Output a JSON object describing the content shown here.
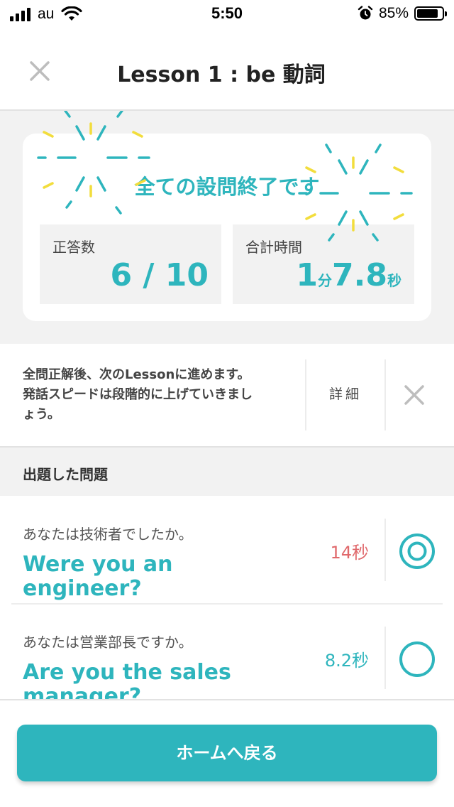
{
  "status_bar": {
    "carrier": "au",
    "time": "5:50",
    "battery": "85%",
    "battery_level": 0.85
  },
  "nav": {
    "title": "Lesson 1 : be 動詞",
    "close_icon": "close-icon"
  },
  "result": {
    "title": "全ての設問終了です",
    "correct_label": "正答数",
    "correct_value": "6 / 10",
    "time_label": "合計時間",
    "time_min": "1",
    "time_min_unit": "分",
    "time_sec": "7.8",
    "time_sec_unit": "秒"
  },
  "info": {
    "line1": "全問正解後、次のLessonに進めます。",
    "line2": "発話スピードは段階的に上げていきまし",
    "line3": "ょう。",
    "detail_label": "詳細"
  },
  "questions_section": {
    "title": "出題した問題",
    "items": [
      {
        "jp": "あなたは技術者でしたか。",
        "en": "Were you an engineer?",
        "time": "14秒",
        "mark": "double-circle-icon",
        "time_color": "#e0696c"
      },
      {
        "jp": "あなたは営業部長ですか。",
        "en": "Are you the sales manager?",
        "time": "8.2秒",
        "mark": "circle-icon",
        "time_color": "#2eb5bd"
      }
    ]
  },
  "footer": {
    "home_label": "ホームへ戻る"
  },
  "colors": {
    "accent": "#2eb5bd",
    "slow": "#e0696c",
    "sparkle_yellow": "#f2dd3c"
  }
}
